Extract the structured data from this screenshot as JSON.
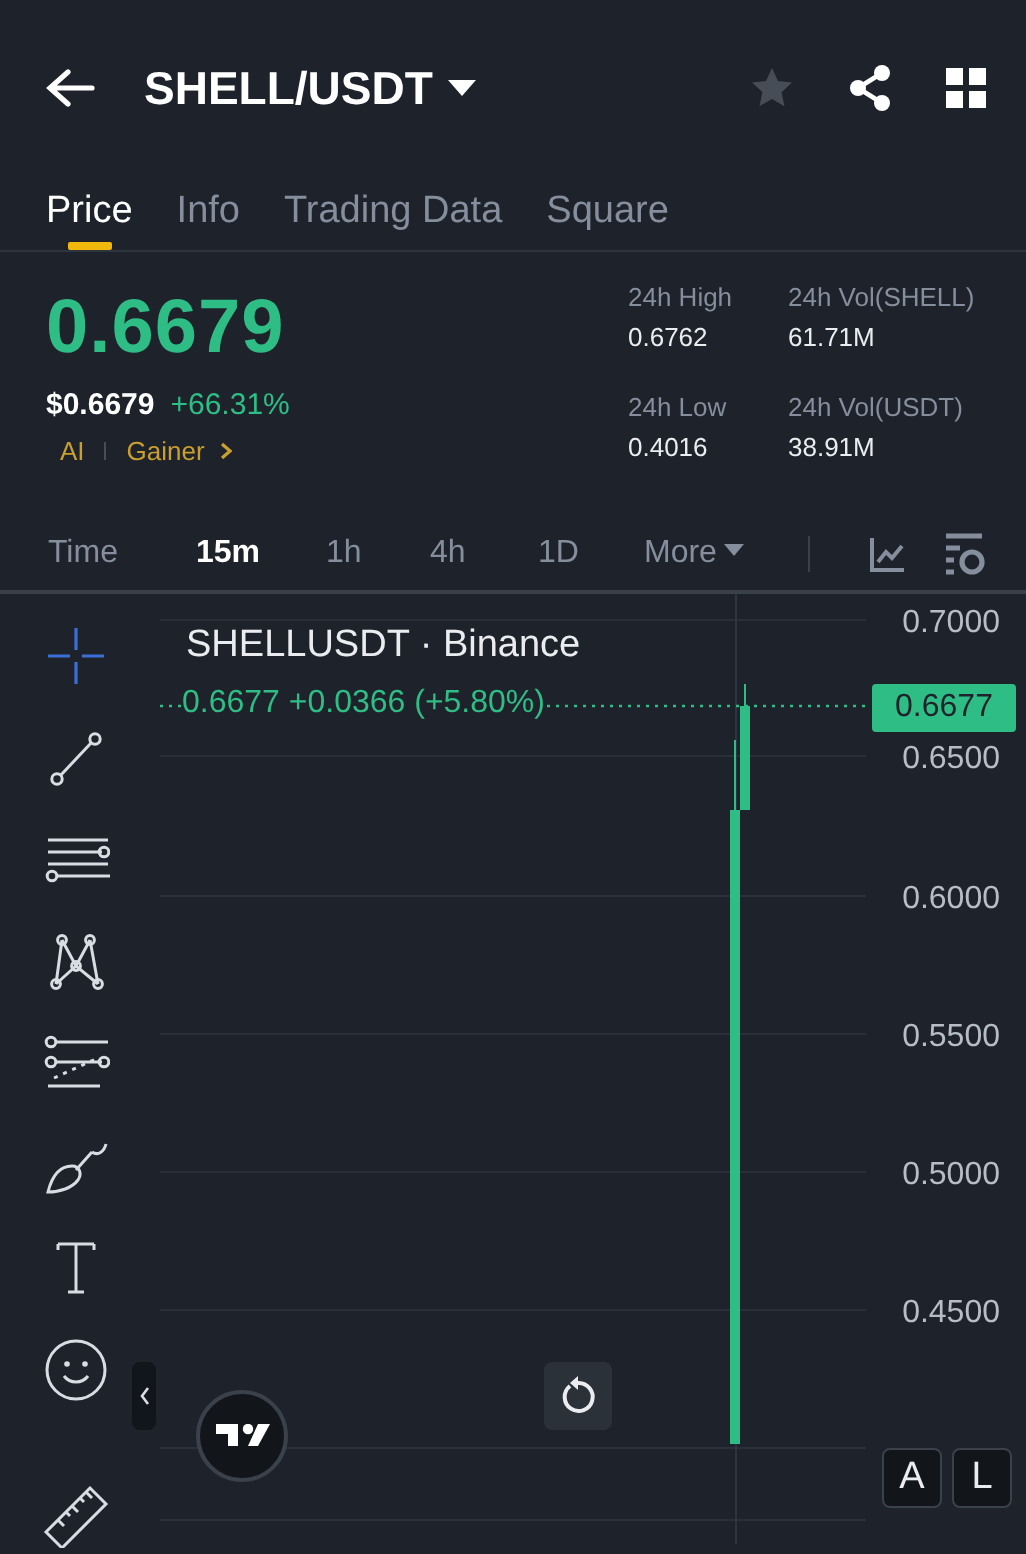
{
  "header": {
    "title": "SHELL/USDT",
    "favorite": false
  },
  "tabs": [
    {
      "label": "Price",
      "selected": true
    },
    {
      "label": "Info",
      "selected": false
    },
    {
      "label": "Trading Data",
      "selected": false
    },
    {
      "label": "Square",
      "selected": false
    }
  ],
  "ticker": {
    "last_price": "0.6679",
    "usd_price": "$0.6679",
    "change": "+66.31%",
    "tags": [
      "AI",
      "Gainer"
    ],
    "stats": [
      {
        "label": "24h High",
        "value": "0.6762"
      },
      {
        "label": "24h Vol(SHELL)",
        "value": "61.71M"
      },
      {
        "label": "24h Low",
        "value": "0.4016"
      },
      {
        "label": "24h Vol(USDT)",
        "value": "38.91M"
      }
    ]
  },
  "intervals": [
    {
      "label": "Time",
      "selected": false
    },
    {
      "label": "15m",
      "selected": true
    },
    {
      "label": "1h",
      "selected": false
    },
    {
      "label": "4h",
      "selected": false
    },
    {
      "label": "1D",
      "selected": false
    },
    {
      "label": "More",
      "selected": false,
      "dropdown": true
    }
  ],
  "drawing_tools": [
    {
      "kind": "crosshair",
      "selected": true
    },
    {
      "kind": "trend-line",
      "selected": false
    },
    {
      "kind": "parallel-lines",
      "selected": false
    },
    {
      "kind": "pattern",
      "selected": false
    },
    {
      "kind": "fibonacci",
      "selected": false
    },
    {
      "kind": "brush",
      "selected": false
    },
    {
      "kind": "text",
      "selected": false
    },
    {
      "kind": "emoji",
      "selected": false
    },
    {
      "kind": "ruler",
      "selected": false
    }
  ],
  "chart": {
    "symbol": "SHELLUSDT · Binance",
    "legend": "0.6677 +0.0366 (+5.80%)",
    "price_tag": "0.6677",
    "price_axis": [
      "0.7000",
      "0.6500",
      "0.6000",
      "0.5500",
      "0.5000",
      "0.4500"
    ]
  },
  "scale_buttons": [
    {
      "label": "A"
    },
    {
      "label": "L"
    }
  ]
}
